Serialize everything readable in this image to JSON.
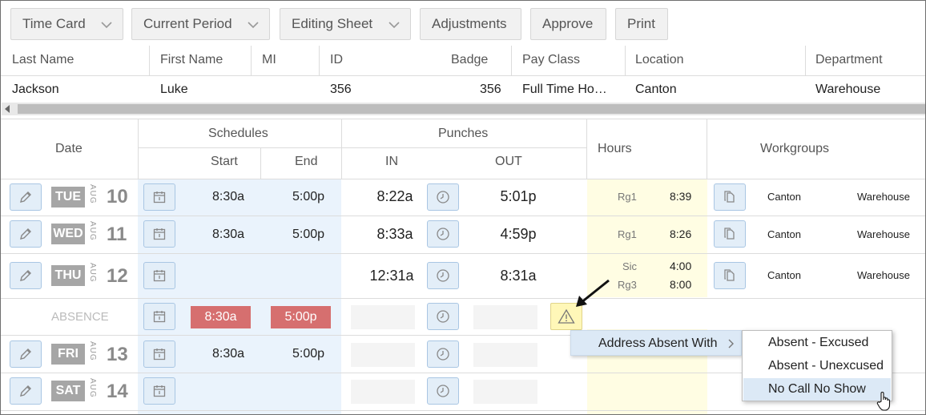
{
  "toolbar": {
    "time_card": "Time Card",
    "current_period": "Current Period",
    "editing_sheet": "Editing Sheet",
    "adjustments": "Adjustments",
    "approve": "Approve",
    "print": "Print"
  },
  "employee": {
    "headers": {
      "last_name": "Last Name",
      "first_name": "First Name",
      "mi": "MI",
      "id": "ID",
      "badge": "Badge",
      "pay_class": "Pay Class",
      "location": "Location",
      "department": "Department"
    },
    "values": {
      "last_name": "Jackson",
      "first_name": "Luke",
      "mi": "",
      "id": "356",
      "badge": "356",
      "pay_class": "Full Time Ho…",
      "location": "Canton",
      "department": "Warehouse"
    }
  },
  "grid": {
    "headers": {
      "date": "Date",
      "schedules": "Schedules",
      "start": "Start",
      "end": "End",
      "punches": "Punches",
      "in": "IN",
      "out": "OUT",
      "hours": "Hours",
      "workgroups": "Workgroups"
    },
    "rows": [
      {
        "day": "TUE",
        "month": "AUG",
        "date": "10",
        "sched_start": "8:30a",
        "sched_end": "5:00p",
        "punch_in": "8:22a",
        "punch_out": "5:01p",
        "hours": [
          {
            "code": "Rg1",
            "value": "8:39"
          }
        ],
        "location": "Canton",
        "department": "Warehouse"
      },
      {
        "day": "WED",
        "month": "AUG",
        "date": "11",
        "sched_start": "8:30a",
        "sched_end": "5:00p",
        "punch_in": "8:33a",
        "punch_out": "4:59p",
        "hours": [
          {
            "code": "Rg1",
            "value": "8:26"
          }
        ],
        "location": "Canton",
        "department": "Warehouse"
      },
      {
        "day": "THU",
        "month": "AUG",
        "date": "12",
        "sched_start": "",
        "sched_end": "",
        "punch_in": "12:31a",
        "punch_out": "8:31a",
        "hours": [
          {
            "code": "Sic",
            "value": "4:00"
          },
          {
            "code": "Rg3",
            "value": "8:00"
          }
        ],
        "location": "Canton",
        "department": "Warehouse"
      },
      {
        "label": "ABSENCE",
        "sched_start": "8:30a",
        "sched_end": "5:00p"
      },
      {
        "day": "FRI",
        "month": "AUG",
        "date": "13",
        "sched_start": "8:30a",
        "sched_end": "5:00p"
      },
      {
        "day": "SAT",
        "month": "AUG",
        "date": "14",
        "sched_start": "",
        "sched_end": ""
      }
    ]
  },
  "context_menu": {
    "parent": "Address Absent With",
    "items": [
      "Absent - Excused",
      "Absent - Unexcused",
      "No Call No Show"
    ],
    "selected": "No Call No Show"
  },
  "colors": {
    "absence_red": "#d66f6f",
    "schedule_blue": "#eaf3fc",
    "hours_yellow": "#fffde3",
    "warning_yellow": "#fff7b8"
  }
}
